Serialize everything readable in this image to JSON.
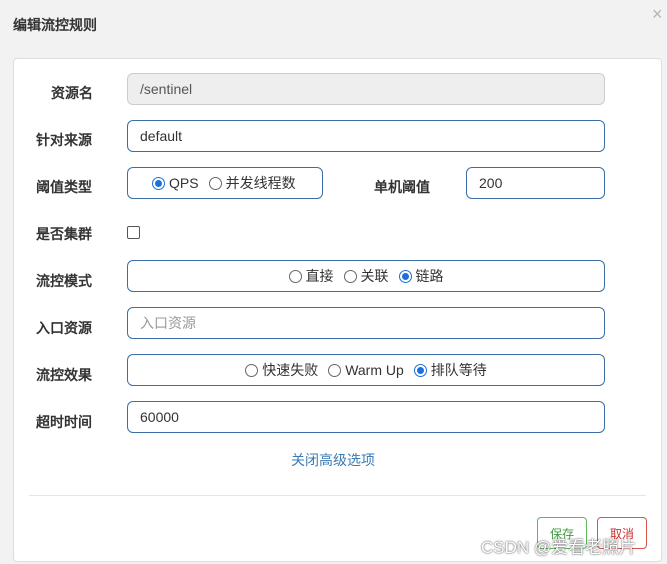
{
  "dialog": {
    "title": "编辑流控规则",
    "close": "×"
  },
  "form": {
    "resource_name": {
      "label": "资源名",
      "value": "/sentinel"
    },
    "limit_app": {
      "label": "针对来源",
      "value": "default"
    },
    "grade": {
      "label": "阈值类型",
      "options": [
        {
          "label": "QPS",
          "selected": true
        },
        {
          "label": "并发线程数",
          "selected": false
        }
      ]
    },
    "threshold": {
      "label": "单机阈值",
      "value": "200"
    },
    "cluster": {
      "label": "是否集群",
      "checked": false
    },
    "strategy": {
      "label": "流控模式",
      "options": [
        {
          "label": "直接",
          "selected": false
        },
        {
          "label": "关联",
          "selected": false
        },
        {
          "label": "链路",
          "selected": true
        }
      ]
    },
    "entry_resource": {
      "label": "入口资源",
      "value": "",
      "placeholder": "入口资源"
    },
    "control_behavior": {
      "label": "流控效果",
      "options": [
        {
          "label": "快速失败",
          "selected": false
        },
        {
          "label": "Warm Up",
          "selected": false
        },
        {
          "label": "排队等待",
          "selected": true
        }
      ]
    },
    "timeout": {
      "label": "超时时间",
      "value": "60000"
    },
    "advanced_toggle": "关闭高级选项"
  },
  "footer": {
    "save": "保存",
    "cancel": "取消"
  },
  "watermark": "CSDN @爱看老照片",
  "colors": {
    "accent_border": "#3a6ea5",
    "save": "#5cb85c",
    "cancel": "#d9534f",
    "link": "#3a7ab5"
  }
}
